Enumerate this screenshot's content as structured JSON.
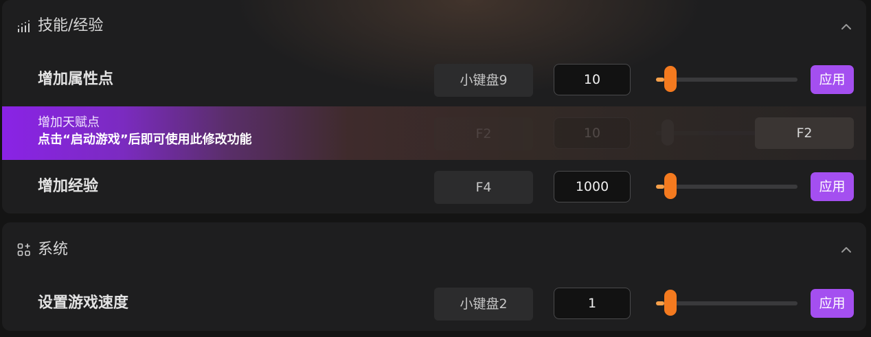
{
  "sections": {
    "skills": {
      "title": "技能/经验",
      "icon": "bar-chart-icon",
      "rows": {
        "attribute": {
          "label": "增加属性点",
          "hotkey": "小键盘9",
          "value": "10",
          "slider_fraction": 0.1,
          "apply_label": "应用"
        },
        "talent": {
          "label": "增加天赋点",
          "hint": "点击“启动游戏”后即可使用此修改功能",
          "hotkey": "F2",
          "value": "10",
          "button_label": "F2",
          "locked": true
        },
        "experience": {
          "label": "增加经验",
          "hotkey": "F4",
          "value": "1000",
          "slider_fraction": 0.1,
          "apply_label": "应用"
        }
      }
    },
    "system": {
      "title": "系统",
      "icon": "grid-add-icon",
      "rows": {
        "speed": {
          "label": "设置游戏速度",
          "hotkey": "小键盘2",
          "value": "1",
          "slider_fraction": 0.1,
          "apply_label": "应用"
        }
      }
    }
  },
  "colors": {
    "accent_purple": "#a44ff0",
    "slider_orange": "#f47a1f",
    "slider_fill": "#f6a04a",
    "panel_bg": "#1e1e1f"
  }
}
